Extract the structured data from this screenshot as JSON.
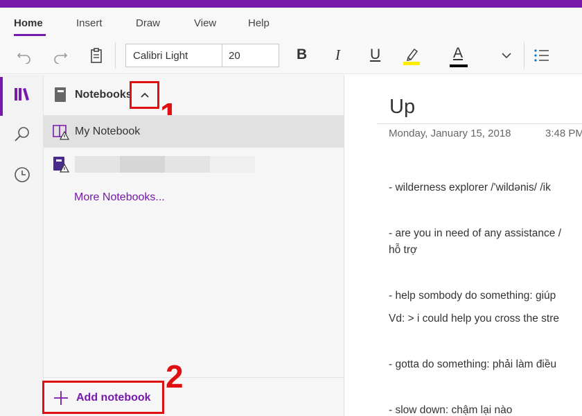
{
  "ribbon": {
    "tabs": [
      "Home",
      "Insert",
      "Draw",
      "View",
      "Help"
    ],
    "active_tab": "Home",
    "font_name": "Calibri Light",
    "font_size": "20",
    "bold_label": "B",
    "italic_label": "I",
    "underline_label": "U",
    "font_color_label": "A",
    "highlight_color": "#ffee00",
    "font_color": "#000000"
  },
  "notebooks": {
    "header_label": "Notebooks",
    "items": [
      {
        "label": "My Notebook",
        "selected": true
      },
      {
        "label": "",
        "blurred": true
      }
    ],
    "more_link": "More Notebooks...",
    "add_label": "Add notebook"
  },
  "callouts": {
    "one": "1",
    "two": "2"
  },
  "page": {
    "title": "Up",
    "date": "Monday, January 15, 2018",
    "time": "3:48 PM",
    "lines": [
      "- wilderness explorer  /'wildənis/ /ik",
      "- are you in need of any assistance /",
      "hỗ trợ",
      "- help sombody do something: giúp",
      "Vd: > i could help you cross the stre",
      "- gotta do something: phải làm điều",
      "- slow down: chậm lại nào"
    ]
  },
  "colors": {
    "accent": "#7719aa",
    "callout": "#e01010"
  }
}
